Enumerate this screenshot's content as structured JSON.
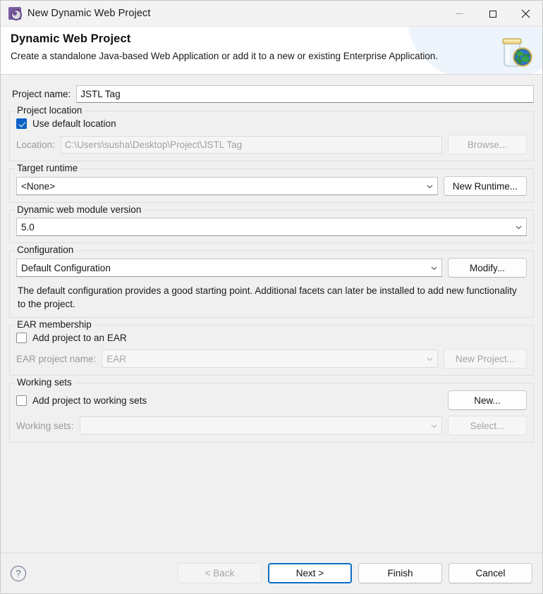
{
  "window": {
    "title": "New Dynamic Web Project",
    "icon": "eclipse-wizard-icon",
    "minimize_label": "Minimize",
    "maximize_label": "Maximize",
    "close_label": "Close"
  },
  "banner": {
    "heading": "Dynamic Web Project",
    "subtext": "Create a standalone Java-based Web Application or add it to a new or existing Enterprise Application.",
    "icon": "web-project-jar-globe-icon"
  },
  "form": {
    "project_name": {
      "label": "Project name:",
      "value": "JSTL Tag"
    },
    "project_location": {
      "legend": "Project location",
      "use_default_label": "Use default location",
      "use_default_checked": true,
      "location_label": "Location:",
      "location_value": "C:\\Users\\susha\\Desktop\\Project\\JSTL Tag",
      "browse_label": "Browse..."
    },
    "target_runtime": {
      "legend": "Target runtime",
      "value": "<None>",
      "new_runtime_label": "New Runtime..."
    },
    "module_version": {
      "legend": "Dynamic web module version",
      "value": "5.0"
    },
    "configuration": {
      "legend": "Configuration",
      "value": "Default Configuration",
      "modify_label": "Modify...",
      "description": "The default configuration provides a good starting point. Additional facets can later be installed to add new functionality to the project."
    },
    "ear_membership": {
      "legend": "EAR membership",
      "add_to_ear_label": "Add project to an EAR",
      "add_to_ear_checked": false,
      "ear_project_name_label": "EAR project name:",
      "ear_project_name_value": "EAR",
      "new_project_label": "New Project..."
    },
    "working_sets": {
      "legend": "Working sets",
      "add_to_working_sets_label": "Add project to working sets",
      "add_to_working_sets_checked": false,
      "working_sets_label": "Working sets:",
      "working_sets_value": "",
      "new_label": "New...",
      "select_label": "Select..."
    }
  },
  "footer": {
    "help_glyph": "?",
    "back_label": "< Back",
    "next_label": "Next >",
    "finish_label": "Finish",
    "cancel_label": "Cancel"
  },
  "colors": {
    "accent": "#0b61c4",
    "focus_border": "#0b6ec4",
    "dialog_bg": "#f0f0f0",
    "banner_bg": "#ffffff"
  }
}
